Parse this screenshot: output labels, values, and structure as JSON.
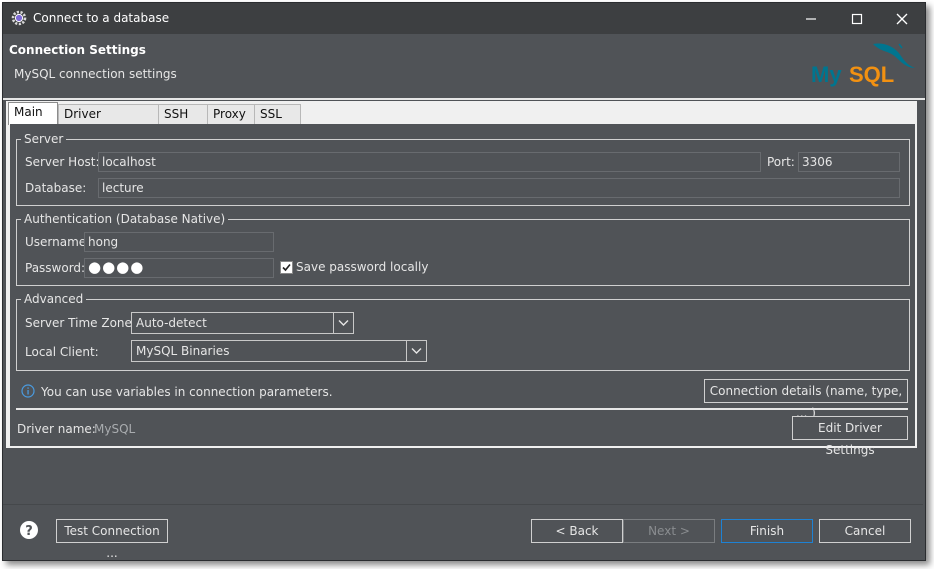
{
  "window": {
    "title": "Connect to a database"
  },
  "header": {
    "title": "Connection Settings",
    "subtitle": "MySQL connection settings",
    "logo_text": "MySQL"
  },
  "tabs": [
    {
      "label": "Main",
      "active": true
    },
    {
      "label": "Driver properties",
      "active": false
    },
    {
      "label": "SSH",
      "active": false
    },
    {
      "label": "Proxy",
      "active": false
    },
    {
      "label": "SSL",
      "active": false
    }
  ],
  "server": {
    "legend": "Server",
    "host_label": "Server Host:",
    "host_value": "localhost",
    "port_label": "Port:",
    "port_value": "3306",
    "database_label": "Database:",
    "database_value": "lecture"
  },
  "auth": {
    "legend": "Authentication (Database Native)",
    "username_label": "Username:",
    "username_value": "hong",
    "password_label": "Password:",
    "password_value": "●●●●",
    "save_password_label": "Save password locally",
    "save_password_checked": true
  },
  "advanced": {
    "legend": "Advanced",
    "timezone_label": "Server Time Zone:",
    "timezone_value": "Auto-detect",
    "client_label": "Local Client:",
    "client_value": "MySQL Binaries"
  },
  "info": {
    "text": "You can use variables in connection parameters.",
    "details_button": "Connection details (name, type, ... )"
  },
  "driver": {
    "label": "Driver name:",
    "value": "MySQL",
    "edit_button": "Edit Driver Settings"
  },
  "footer": {
    "test_button": "Test Connection ...",
    "back_button": "< Back",
    "next_button": "Next >",
    "finish_button": "Finish",
    "cancel_button": "Cancel"
  },
  "colors": {
    "background": "#505357",
    "accent": "#1e82d4",
    "logo_blue": "#00758f",
    "logo_orange": "#f29111"
  },
  "icons": [
    "app-gear-icon",
    "minimize-icon",
    "maximize-icon",
    "close-icon",
    "info-icon",
    "help-icon",
    "chevron-down-icon",
    "checkmark-icon"
  ]
}
